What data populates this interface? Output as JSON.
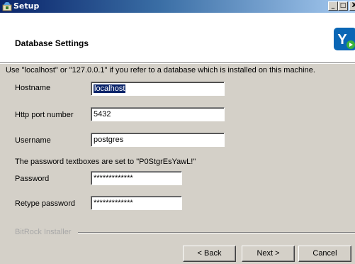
{
  "window": {
    "title": "Setup",
    "app_icon": "setup-app-icon",
    "controls": {
      "minimize": "_",
      "maximize": "□",
      "close": "X"
    }
  },
  "header": {
    "title": "Database Settings",
    "logo_letter": "Y",
    "logo_colors": {
      "primary": "#0a66b5",
      "accent": "#3cb33c"
    }
  },
  "content": {
    "info_text": "Use \"localhost\" or \"127.0.0.1\" if you refer to a database which is installed on this machine.",
    "hostname": {
      "label": "Hostname",
      "value": "localhost"
    },
    "http_port": {
      "label": "Http port number",
      "value": "5432"
    },
    "username": {
      "label": "Username",
      "value": "postgres"
    },
    "password_note": "The password textboxes are set to \"P0StgrEsYawL!\"",
    "password": {
      "label": "Password",
      "value": "*************"
    },
    "retype_password": {
      "label": "Retype password",
      "value": "*************"
    }
  },
  "footer": {
    "brand": "BitRock Installer",
    "back_label": "< Back",
    "next_label": "Next >",
    "cancel_label": "Cancel"
  }
}
